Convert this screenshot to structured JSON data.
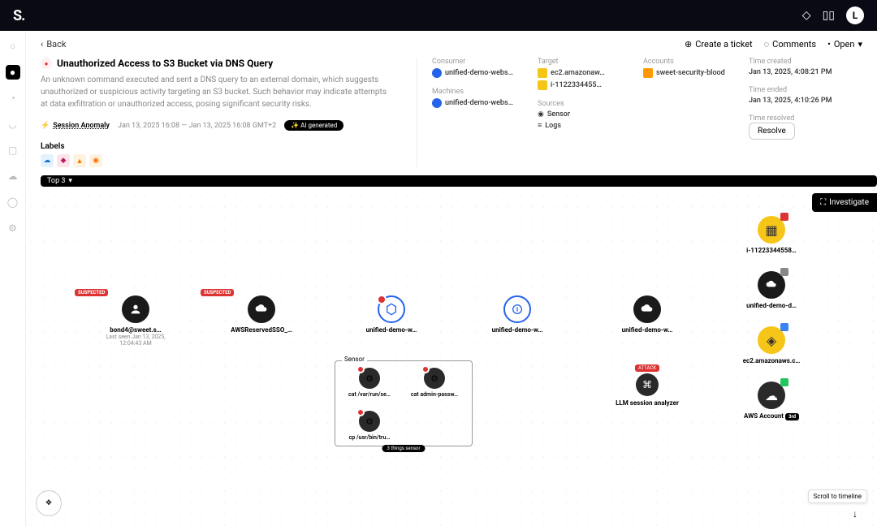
{
  "topbar": {
    "logo": "S.",
    "avatar_initial": "L"
  },
  "header": {
    "back": "Back",
    "create_ticket": "Create a ticket",
    "comments": "Comments",
    "open": "Open"
  },
  "issue": {
    "title": "Unauthorized Access to S3 Bucket via DNS Query",
    "description": "An unknown command executed and sent a DNS query to an external domain, which suggests unauthorized or suspicious activity targeting an S3 bucket. Such behavior may indicate attempts at data exfiltration or unauthorized access, posing significant security risks.",
    "anomaly_label": "Session Anomaly",
    "time_range": "Jan 13, 2025 16:08   —   Jan 13, 2025 16:08  GMT+2",
    "ai_pill": "✨ AI generated",
    "labels_title": "Labels"
  },
  "info": {
    "consumer_label": "Consumer",
    "consumer_val": "unified-demo-webs…",
    "machines_label": "Machines",
    "machines_val": "unified-demo-webs…",
    "target_label": "Target",
    "target_val1": "ec2.amazonaw…",
    "target_val2": "i-1122334455…",
    "sources_label": "Sources",
    "sources_val1": "Sensor",
    "sources_val2": "Logs",
    "accounts_label": "Accounts",
    "accounts_val": "sweet-security-blood",
    "time_created_label": "Time created",
    "time_created_val": "Jan 13, 2025, 4:08:21 PM",
    "time_ended_label": "Time ended",
    "time_ended_val": "Jan 13, 2025, 4:10:26 PM",
    "time_resolved_label": "Time resolved",
    "resolve_btn": "Resolve"
  },
  "top_pill": "Top 3",
  "investigate": "Investigate",
  "nodes": {
    "user": {
      "label": "bond4@sweet.s…",
      "sub": "Last seen Jan 13, 2025, 12:04:43 AM",
      "tag": "SUSPECTED"
    },
    "role": {
      "label": "AWSReservedSSO_…",
      "tag": "SUSPECTED"
    },
    "svc1": {
      "label": "unified-demo-w…"
    },
    "svc2": {
      "label": "unified-demo-w…"
    },
    "svc3": {
      "label": "unified-demo-w…"
    },
    "inst": {
      "label": "i-11223344558…"
    },
    "pod": {
      "label": "unified-demo-d…"
    },
    "ec2": {
      "label": "ec2.amazonaws.c…"
    },
    "acct": {
      "label": "AWS Account",
      "pill": "3rd"
    },
    "llm": {
      "label": "LLM session analyzer",
      "tag": "ATTACK"
    }
  },
  "sensor": {
    "title": "Sensor",
    "cmd1": "cat /var/run/se…",
    "cmd2": "cat admin-passw…",
    "cmd3": "cp /usr/bin/tru…",
    "footer": "3 things sensor"
  },
  "scroll_hint": "Scroll to timeline"
}
